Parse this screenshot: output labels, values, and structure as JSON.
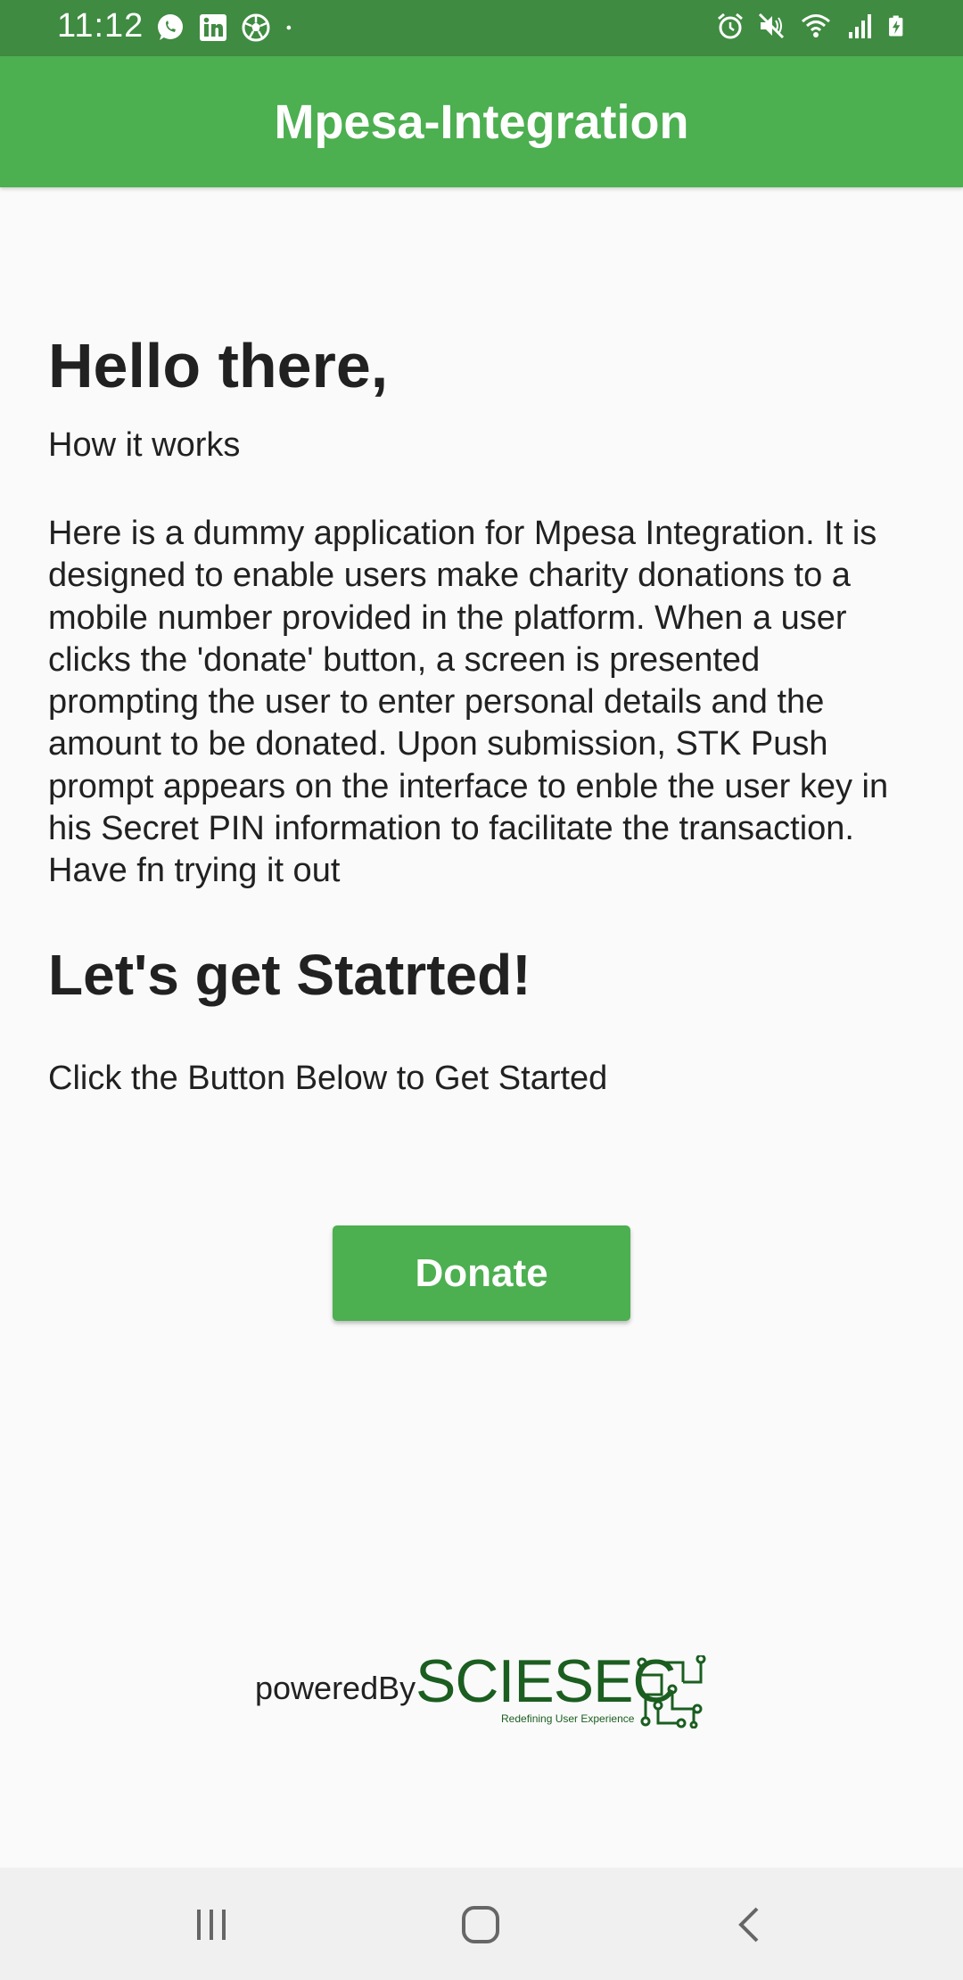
{
  "status_bar": {
    "time": "11:12",
    "left_icons": [
      "whatsapp-icon",
      "linkedin-icon",
      "soccer-ball-icon",
      "dot-icon"
    ],
    "right_icons": [
      "alarm-icon",
      "mute-icon",
      "wifi-icon",
      "signal-icon",
      "battery-charging-icon"
    ]
  },
  "app_bar": {
    "title": "Mpesa-Integration"
  },
  "main": {
    "greeting": "Hello there,",
    "subtitle": "How it works",
    "description": "Here is a dummy application for Mpesa Integration. It is designed to enable users make charity donations to a mobile number provided in the platform. When a user clicks the 'donate' button, a screen is presented prompting the user to enter personal details and the amount to be donated. Upon submission, STK Push prompt appears on the interface to enble the user key in his Secret PIN information to facilitate the transaction. Have fn trying it out",
    "cta_heading": "Let's get Statrted!",
    "cta_text": "Click the Button Below to Get Started",
    "donate_label": "Donate"
  },
  "footer": {
    "powered_by": "poweredBy",
    "brand_name": "SCIESEC",
    "brand_tagline": "Redefining User Experience"
  },
  "nav_bar": {
    "buttons": [
      "recent-apps-icon",
      "home-icon",
      "back-icon"
    ]
  },
  "colors": {
    "status_bar": "#3f8b41",
    "primary": "#4caf50",
    "brand": "#1b5e20",
    "background": "#fafafa"
  }
}
